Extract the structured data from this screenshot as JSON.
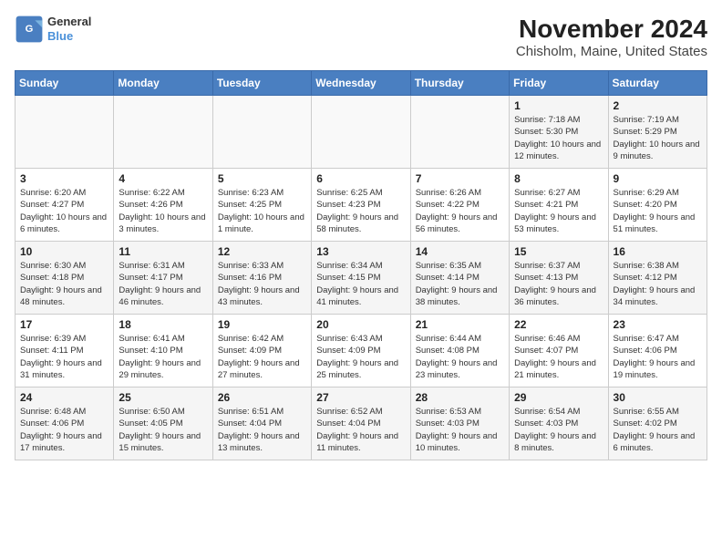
{
  "logo": {
    "line1": "General",
    "line2": "Blue"
  },
  "title": "November 2024",
  "subtitle": "Chisholm, Maine, United States",
  "weekdays": [
    "Sunday",
    "Monday",
    "Tuesday",
    "Wednesday",
    "Thursday",
    "Friday",
    "Saturday"
  ],
  "weeks": [
    [
      {
        "day": "",
        "content": ""
      },
      {
        "day": "",
        "content": ""
      },
      {
        "day": "",
        "content": ""
      },
      {
        "day": "",
        "content": ""
      },
      {
        "day": "",
        "content": ""
      },
      {
        "day": "1",
        "content": "Sunrise: 7:18 AM\nSunset: 5:30 PM\nDaylight: 10 hours and 12 minutes."
      },
      {
        "day": "2",
        "content": "Sunrise: 7:19 AM\nSunset: 5:29 PM\nDaylight: 10 hours and 9 minutes."
      }
    ],
    [
      {
        "day": "3",
        "content": "Sunrise: 6:20 AM\nSunset: 4:27 PM\nDaylight: 10 hours and 6 minutes."
      },
      {
        "day": "4",
        "content": "Sunrise: 6:22 AM\nSunset: 4:26 PM\nDaylight: 10 hours and 3 minutes."
      },
      {
        "day": "5",
        "content": "Sunrise: 6:23 AM\nSunset: 4:25 PM\nDaylight: 10 hours and 1 minute."
      },
      {
        "day": "6",
        "content": "Sunrise: 6:25 AM\nSunset: 4:23 PM\nDaylight: 9 hours and 58 minutes."
      },
      {
        "day": "7",
        "content": "Sunrise: 6:26 AM\nSunset: 4:22 PM\nDaylight: 9 hours and 56 minutes."
      },
      {
        "day": "8",
        "content": "Sunrise: 6:27 AM\nSunset: 4:21 PM\nDaylight: 9 hours and 53 minutes."
      },
      {
        "day": "9",
        "content": "Sunrise: 6:29 AM\nSunset: 4:20 PM\nDaylight: 9 hours and 51 minutes."
      }
    ],
    [
      {
        "day": "10",
        "content": "Sunrise: 6:30 AM\nSunset: 4:18 PM\nDaylight: 9 hours and 48 minutes."
      },
      {
        "day": "11",
        "content": "Sunrise: 6:31 AM\nSunset: 4:17 PM\nDaylight: 9 hours and 46 minutes."
      },
      {
        "day": "12",
        "content": "Sunrise: 6:33 AM\nSunset: 4:16 PM\nDaylight: 9 hours and 43 minutes."
      },
      {
        "day": "13",
        "content": "Sunrise: 6:34 AM\nSunset: 4:15 PM\nDaylight: 9 hours and 41 minutes."
      },
      {
        "day": "14",
        "content": "Sunrise: 6:35 AM\nSunset: 4:14 PM\nDaylight: 9 hours and 38 minutes."
      },
      {
        "day": "15",
        "content": "Sunrise: 6:37 AM\nSunset: 4:13 PM\nDaylight: 9 hours and 36 minutes."
      },
      {
        "day": "16",
        "content": "Sunrise: 6:38 AM\nSunset: 4:12 PM\nDaylight: 9 hours and 34 minutes."
      }
    ],
    [
      {
        "day": "17",
        "content": "Sunrise: 6:39 AM\nSunset: 4:11 PM\nDaylight: 9 hours and 31 minutes."
      },
      {
        "day": "18",
        "content": "Sunrise: 6:41 AM\nSunset: 4:10 PM\nDaylight: 9 hours and 29 minutes."
      },
      {
        "day": "19",
        "content": "Sunrise: 6:42 AM\nSunset: 4:09 PM\nDaylight: 9 hours and 27 minutes."
      },
      {
        "day": "20",
        "content": "Sunrise: 6:43 AM\nSunset: 4:09 PM\nDaylight: 9 hours and 25 minutes."
      },
      {
        "day": "21",
        "content": "Sunrise: 6:44 AM\nSunset: 4:08 PM\nDaylight: 9 hours and 23 minutes."
      },
      {
        "day": "22",
        "content": "Sunrise: 6:46 AM\nSunset: 4:07 PM\nDaylight: 9 hours and 21 minutes."
      },
      {
        "day": "23",
        "content": "Sunrise: 6:47 AM\nSunset: 4:06 PM\nDaylight: 9 hours and 19 minutes."
      }
    ],
    [
      {
        "day": "24",
        "content": "Sunrise: 6:48 AM\nSunset: 4:06 PM\nDaylight: 9 hours and 17 minutes."
      },
      {
        "day": "25",
        "content": "Sunrise: 6:50 AM\nSunset: 4:05 PM\nDaylight: 9 hours and 15 minutes."
      },
      {
        "day": "26",
        "content": "Sunrise: 6:51 AM\nSunset: 4:04 PM\nDaylight: 9 hours and 13 minutes."
      },
      {
        "day": "27",
        "content": "Sunrise: 6:52 AM\nSunset: 4:04 PM\nDaylight: 9 hours and 11 minutes."
      },
      {
        "day": "28",
        "content": "Sunrise: 6:53 AM\nSunset: 4:03 PM\nDaylight: 9 hours and 10 minutes."
      },
      {
        "day": "29",
        "content": "Sunrise: 6:54 AM\nSunset: 4:03 PM\nDaylight: 9 hours and 8 minutes."
      },
      {
        "day": "30",
        "content": "Sunrise: 6:55 AM\nSunset: 4:02 PM\nDaylight: 9 hours and 6 minutes."
      }
    ]
  ]
}
